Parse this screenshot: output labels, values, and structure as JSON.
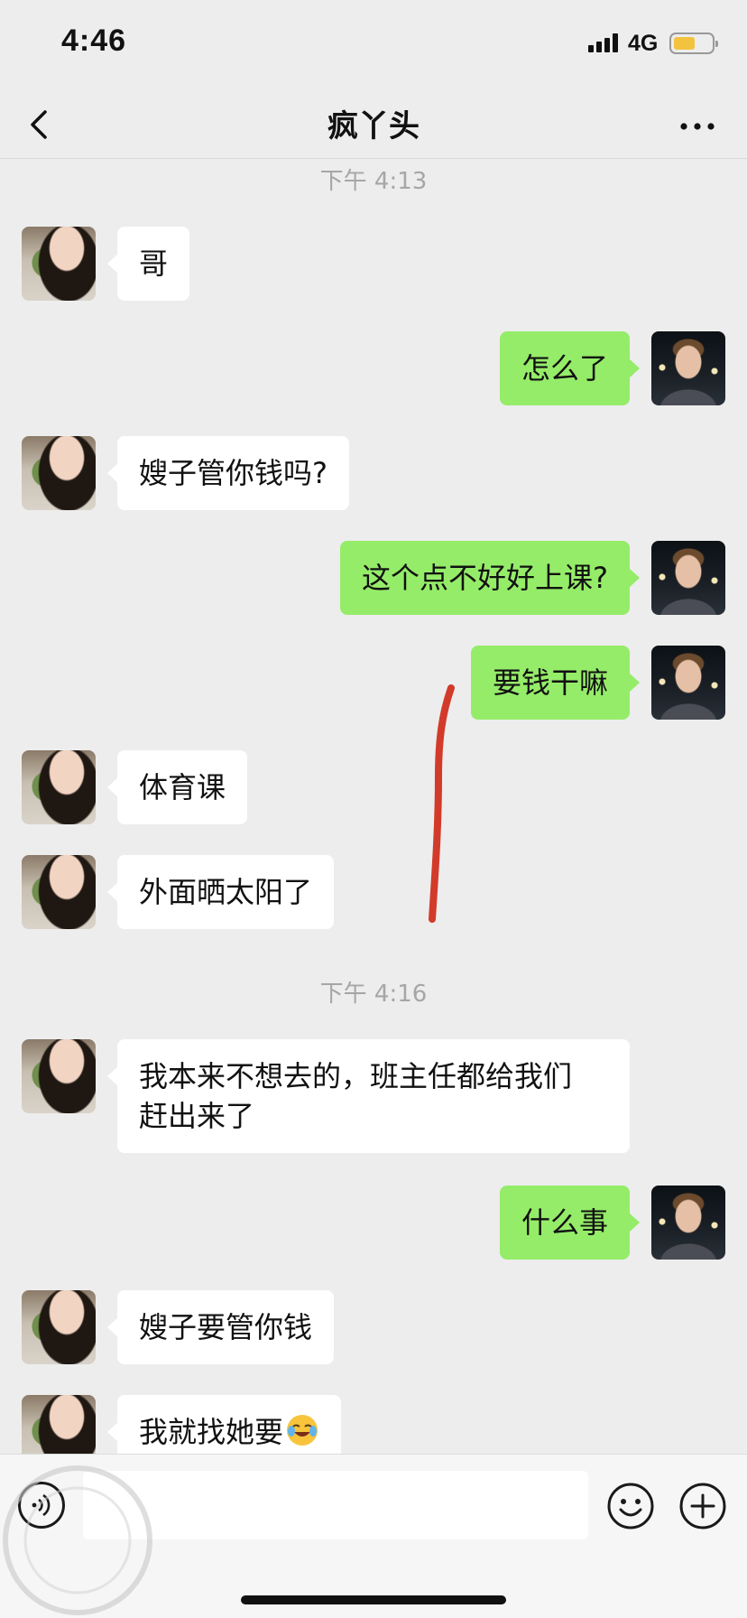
{
  "status_bar": {
    "time": "4:46",
    "network": "4G",
    "battery_color": "#f3c33f"
  },
  "header": {
    "title": "疯丫头",
    "back_icon": "chevron-left-icon",
    "more_icon": "more-dots-icon"
  },
  "chat": {
    "separators": [
      "下午 4:13",
      "下午 4:16"
    ],
    "messages": [
      {
        "side": "left",
        "text": "哥"
      },
      {
        "side": "right",
        "text": "怎么了"
      },
      {
        "side": "left",
        "text": "嫂子管你钱吗?"
      },
      {
        "side": "right",
        "text": "这个点不好好上课?"
      },
      {
        "side": "right",
        "text": "要钱干嘛"
      },
      {
        "side": "left",
        "text": "体育课"
      },
      {
        "side": "left",
        "text": "外面晒太阳了"
      },
      {
        "side": "left",
        "text": "我本来不想去的，班主任都给我们\n赶出来了"
      },
      {
        "side": "right",
        "text": "什么事"
      },
      {
        "side": "left",
        "text": "嫂子要管你钱"
      },
      {
        "side": "left",
        "text": "我就找她要",
        "emoji": "crying-laughing-emoji-icon"
      }
    ],
    "colors": {
      "incoming_bubble": "#ffffff",
      "outgoing_bubble": "#95ec69",
      "annotation_stroke": "#d23a2a"
    }
  },
  "input_bar": {
    "message_value": "",
    "voice_icon": "voice-icon",
    "emoji_icon": "smiley-icon",
    "plus_icon": "plus-circle-icon"
  }
}
